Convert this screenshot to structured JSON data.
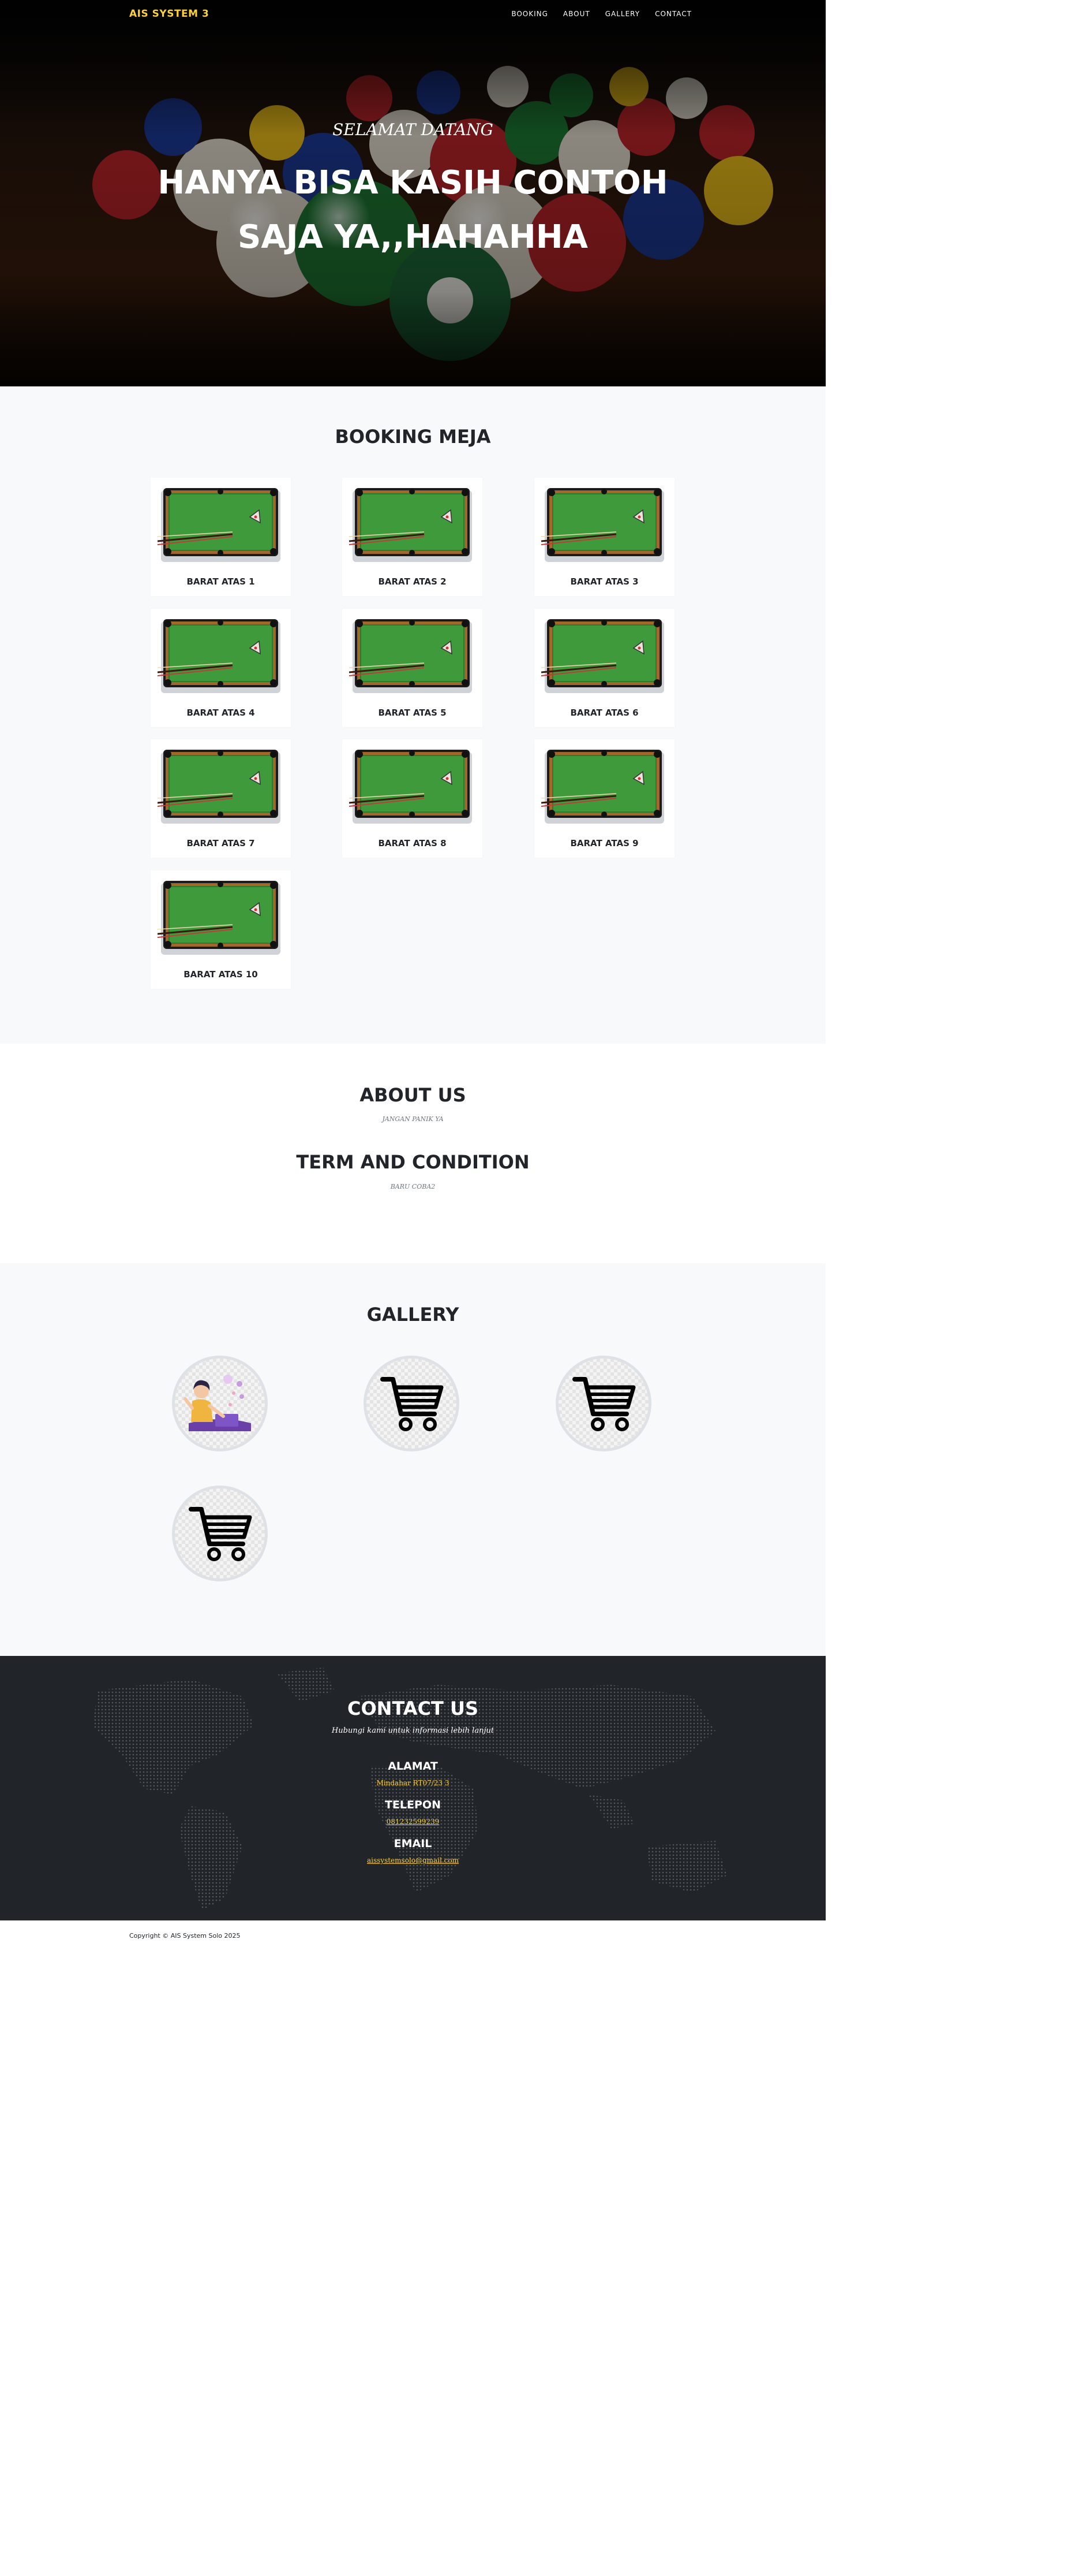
{
  "nav": {
    "brand": "AIS SYSTEM 3",
    "items": [
      "BOOKING",
      "ABOUT",
      "GALLERY",
      "CONTACT"
    ]
  },
  "hero": {
    "subheading": "SELAMAT DATANG",
    "heading": "HANYA BISA KASIH CONTOH SAJA YA,,HAHAHHA"
  },
  "booking": {
    "title": "BOOKING MEJA",
    "tables": [
      "BARAT ATAS 1",
      "BARAT ATAS 2",
      "BARAT ATAS 3",
      "BARAT ATAS 4",
      "BARAT ATAS 5",
      "BARAT ATAS 6",
      "BARAT ATAS 7",
      "BARAT ATAS 8",
      "BARAT ATAS 9",
      "BARAT ATAS 10"
    ]
  },
  "about": {
    "title": "ABOUT US",
    "text": "JANGAN PANIK YA",
    "terms_title": "TERM AND CONDITION",
    "terms_text": "BARU COBA2"
  },
  "gallery": {
    "title": "GALLERY",
    "items": [
      "woman-laptop-illustration",
      "shopping-cart-icon",
      "shopping-cart-icon",
      "shopping-cart-icon"
    ]
  },
  "contact": {
    "title": "CONTACT US",
    "subtitle": "Hubungi kami untuk informasi lebih lanjut",
    "address_label": "ALAMAT",
    "address": "Mindahar RT07/23 3",
    "phone_label": "TELEPON",
    "phone": "081232599239",
    "email_label": "EMAIL",
    "email": "aissystemsolo@gmail.com"
  },
  "footer": {
    "copyright": "Copyright © AIS System Solo 2025"
  },
  "colors": {
    "accent": "#fed136",
    "dark": "#212529",
    "table_felt": "#3f9a3c",
    "light_bg": "#f8f9fa"
  }
}
